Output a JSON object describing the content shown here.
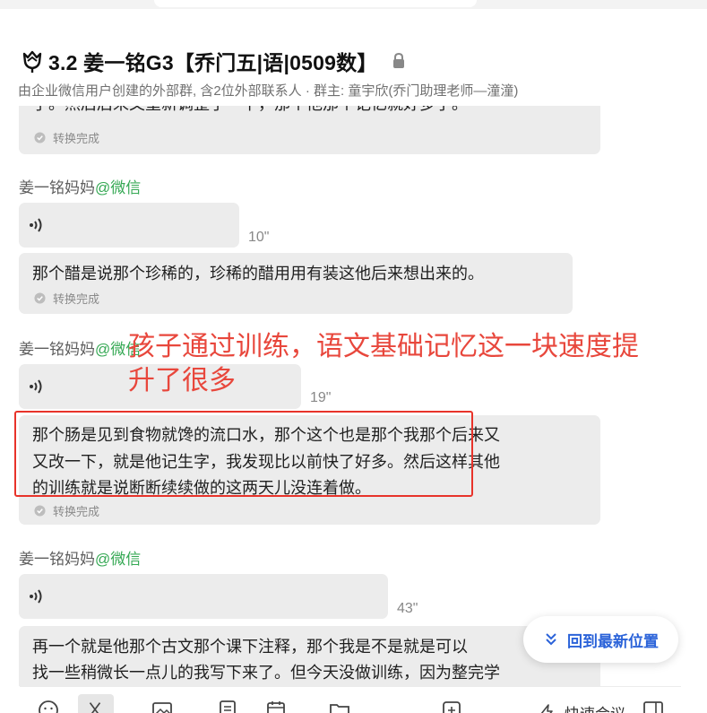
{
  "header": {
    "title": "3.2 姜一铭G3【乔门五|语|0509数】",
    "subtitle": "由企业微信用户创建的外部群, 含2位外部联系人 · 群主: 童宇欣(乔门助理老师—潼潼)"
  },
  "messages": {
    "m0": {
      "text": "了。然后后来又重新调整了一下，那个他那个记忆就好多了。",
      "status": "转换完成"
    },
    "m1": {
      "sender": "姜一铭妈妈",
      "source": "@微信",
      "duration": "10\"",
      "text": "那个醋是说那个珍稀的，珍稀的醋用用有装这他后来想出来的。",
      "status": "转换完成"
    },
    "m2": {
      "sender": "姜一铭妈妈",
      "source": "@微信",
      "duration": "19\"",
      "lines": [
        "那个肠是见到食物就馋的流口水，那个这个也是那个我那个后来又",
        "又改一下，就是他记生字，我发现比以前快了好多。然后这样其他",
        "的训练就是说断断续续做的这两天儿没连着做。"
      ],
      "status": "转换完成"
    },
    "m3": {
      "sender": "姜一铭妈妈",
      "source": "@微信",
      "duration": "43\"",
      "lines": [
        "再一个就是他那个古文那个课下注释，那个我是不是就是可以",
        "找一些稍微长一点儿的我写下来了。但今天没做训练，因为整完学"
      ]
    }
  },
  "annotation": {
    "line1": "孩子通过训练，语文基础记忆这一块速度提",
    "line2": "升了很多"
  },
  "jump_button": {
    "label": "回到最新位置"
  },
  "toolbar": {
    "quick_meeting": "快速会议"
  },
  "colors": {
    "accent": "#2b63d9",
    "annotation": "#e8473c",
    "source": "#34a853",
    "bubble": "#ececec"
  }
}
